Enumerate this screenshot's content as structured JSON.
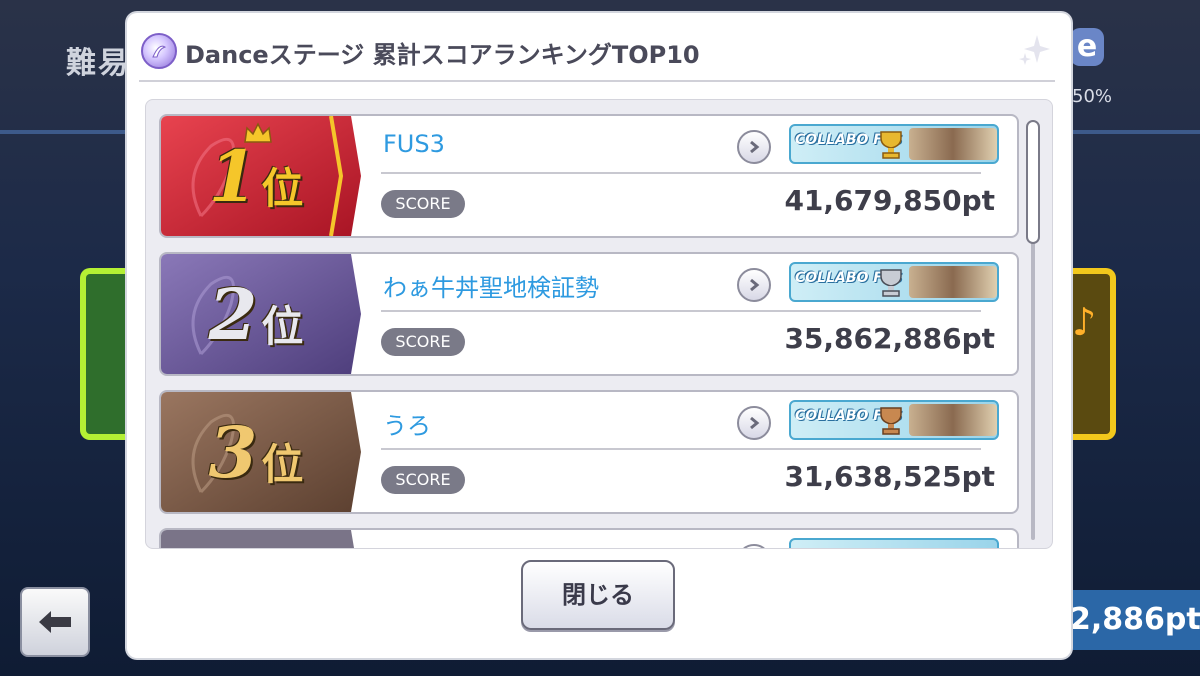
{
  "background": {
    "title_partial": "難易",
    "e_partial": "e",
    "percent_partial": "50%",
    "score_partial": "2,886pt"
  },
  "dialog": {
    "title": "Danceステージ 累計スコアランキングTOP10",
    "close_label": "閉じる"
  },
  "ranking": [
    {
      "rank": "1",
      "suffix": "位",
      "name": "FUS3",
      "score_label": "SCORE",
      "score": "41,679,850pt",
      "badge_text": "COLLABO FES",
      "color": "#d7283a",
      "rank_color": "#f5c62a",
      "trophy": "gold"
    },
    {
      "rank": "2",
      "suffix": "位",
      "name": "わぁ牛丼聖地検証勢",
      "score_label": "SCORE",
      "score": "35,862,886pt",
      "badge_text": "COLLABO FES",
      "color": "#6a5898",
      "rank_color": "#e8e8ee",
      "trophy": "silver"
    },
    {
      "rank": "3",
      "suffix": "位",
      "name": "うろ",
      "score_label": "SCORE",
      "score": "31,638,525pt",
      "badge_text": "COLLABO FES",
      "color": "#8a6650",
      "rank_color": "#f0c870",
      "trophy": "bronze"
    }
  ],
  "icons": [
    "dance-stage-icon",
    "sparkle-icon",
    "chevron-right-icon",
    "back-arrow-icon",
    "trophy-icon"
  ]
}
